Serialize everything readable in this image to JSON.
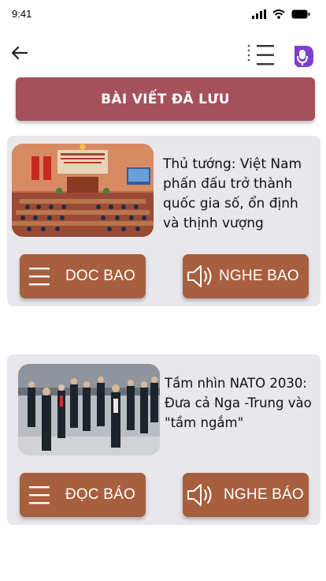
{
  "status_bar": {
    "time": "9:41"
  },
  "header": {
    "back_icon": "arrow-left-icon",
    "menu_icon": "menu-icon",
    "logo_icon": "podcast-mic-logo"
  },
  "banner": {
    "title": "BÀI VIẾT ĐÃ LƯU"
  },
  "colors": {
    "banner": "#a5505a",
    "button": "#a85f3e",
    "card": "#e8e8ec"
  },
  "articles": [
    {
      "title": "Thủ tướng: Việt Nam phấn đấu trở thành quốc gia số, ổn định và thịnh vượng",
      "read_label": "DOC BAO",
      "listen_label": "NGHE BAO"
    },
    {
      "title": "Tầm nhìn NATO 2030: Đưa cả Nga -Trung vào \"tầm ngắm\"",
      "read_label": "ĐỌC BÁO",
      "listen_label": "NGHE BÁO"
    }
  ]
}
